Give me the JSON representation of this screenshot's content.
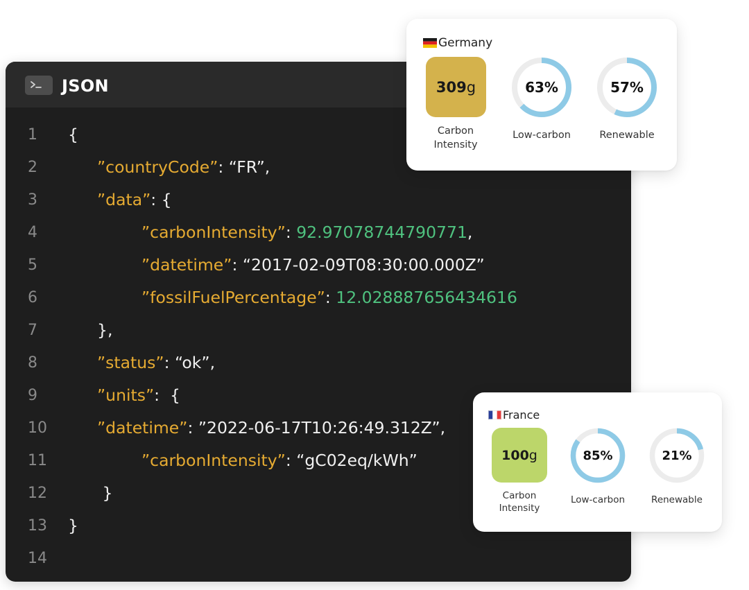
{
  "editor": {
    "title": "JSON",
    "icon": "terminal-icon",
    "lines": [
      {
        "n": "1",
        "indent": 0,
        "tokens": [
          {
            "t": "p",
            "v": "{"
          }
        ]
      },
      {
        "n": "2",
        "indent": 1,
        "tokens": [
          {
            "t": "k",
            "v": "”countryCode”"
          },
          {
            "t": "p",
            "v": ": “FR”,"
          }
        ]
      },
      {
        "n": "3",
        "indent": 1,
        "tokens": [
          {
            "t": "k",
            "v": "”data”"
          },
          {
            "t": "p",
            "v": ": {"
          }
        ]
      },
      {
        "n": "4",
        "indent": 2,
        "tokens": [
          {
            "t": "k",
            "v": "”carbonIntensity”"
          },
          {
            "t": "p",
            "v": ": "
          },
          {
            "t": "n",
            "v": "92.97078744790771"
          },
          {
            "t": "p",
            "v": ","
          }
        ]
      },
      {
        "n": "5",
        "indent": 2,
        "tokens": [
          {
            "t": "k",
            "v": "”datetime”"
          },
          {
            "t": "p",
            "v": ": “2017-02-09T08:30:00.000Z”"
          }
        ]
      },
      {
        "n": "6",
        "indent": 2,
        "tokens": [
          {
            "t": "k",
            "v": "”fossilFuelPercentage”"
          },
          {
            "t": "p",
            "v": ": "
          },
          {
            "t": "n",
            "v": "12.028887656434616"
          }
        ]
      },
      {
        "n": "7",
        "indent": 1,
        "tokens": [
          {
            "t": "p",
            "v": "},"
          }
        ]
      },
      {
        "n": "8",
        "indent": 1,
        "tokens": [
          {
            "t": "k",
            "v": "”status”"
          },
          {
            "t": "p",
            "v": ": “ok”,"
          }
        ]
      },
      {
        "n": "9",
        "indent": 1,
        "tokens": [
          {
            "t": "k",
            "v": "”units”"
          },
          {
            "t": "p",
            "v": ":  {"
          }
        ]
      },
      {
        "n": "10",
        "indent": 1,
        "tokens": [
          {
            "t": "k",
            "v": "”datetime”"
          },
          {
            "t": "p",
            "v": ": ”2022-06-17T10:26:49.312Z”,"
          }
        ]
      },
      {
        "n": "11",
        "indent": 2,
        "tokens": [
          {
            "t": "k",
            "v": "”carbonIntensity”"
          },
          {
            "t": "p",
            "v": ": “gC02eq/kWh”"
          }
        ]
      },
      {
        "n": "12",
        "indent": 1,
        "tokens": [
          {
            "t": "p",
            "v": " }"
          }
        ]
      },
      {
        "n": "13",
        "indent": 0,
        "tokens": [
          {
            "t": "p",
            "v": "}"
          }
        ]
      },
      {
        "n": "14",
        "indent": 0,
        "tokens": []
      }
    ]
  },
  "cards": {
    "germany": {
      "country": "Germany",
      "flag_icon": "germany-flag-icon",
      "carbon_value": "309",
      "carbon_unit": "g",
      "carbon_label_1": "Carbon",
      "carbon_label_2": "Intensity",
      "carbon_color": "#d4b24c",
      "low_carbon_text": "63%",
      "low_carbon_fraction": 0.63,
      "low_carbon_label": "Low-carbon",
      "renewable_text": "57%",
      "renewable_fraction": 0.57,
      "renewable_label": "Renewable"
    },
    "france": {
      "country": "France",
      "flag_icon": "france-flag-icon",
      "carbon_value": "100",
      "carbon_unit": "g",
      "carbon_label_1": "Carbon",
      "carbon_label_2": "Intensity",
      "carbon_color": "#bcd66a",
      "low_carbon_text": "85%",
      "low_carbon_fraction": 0.85,
      "low_carbon_label": "Low-carbon",
      "renewable_text": "21%",
      "renewable_fraction": 0.21,
      "renewable_label": "Renewable"
    }
  },
  "colors": {
    "gauge_fill": "#8ecae6",
    "gauge_track": "#ececec",
    "json_key": "#e6ab32",
    "json_number": "#4fc27f"
  }
}
